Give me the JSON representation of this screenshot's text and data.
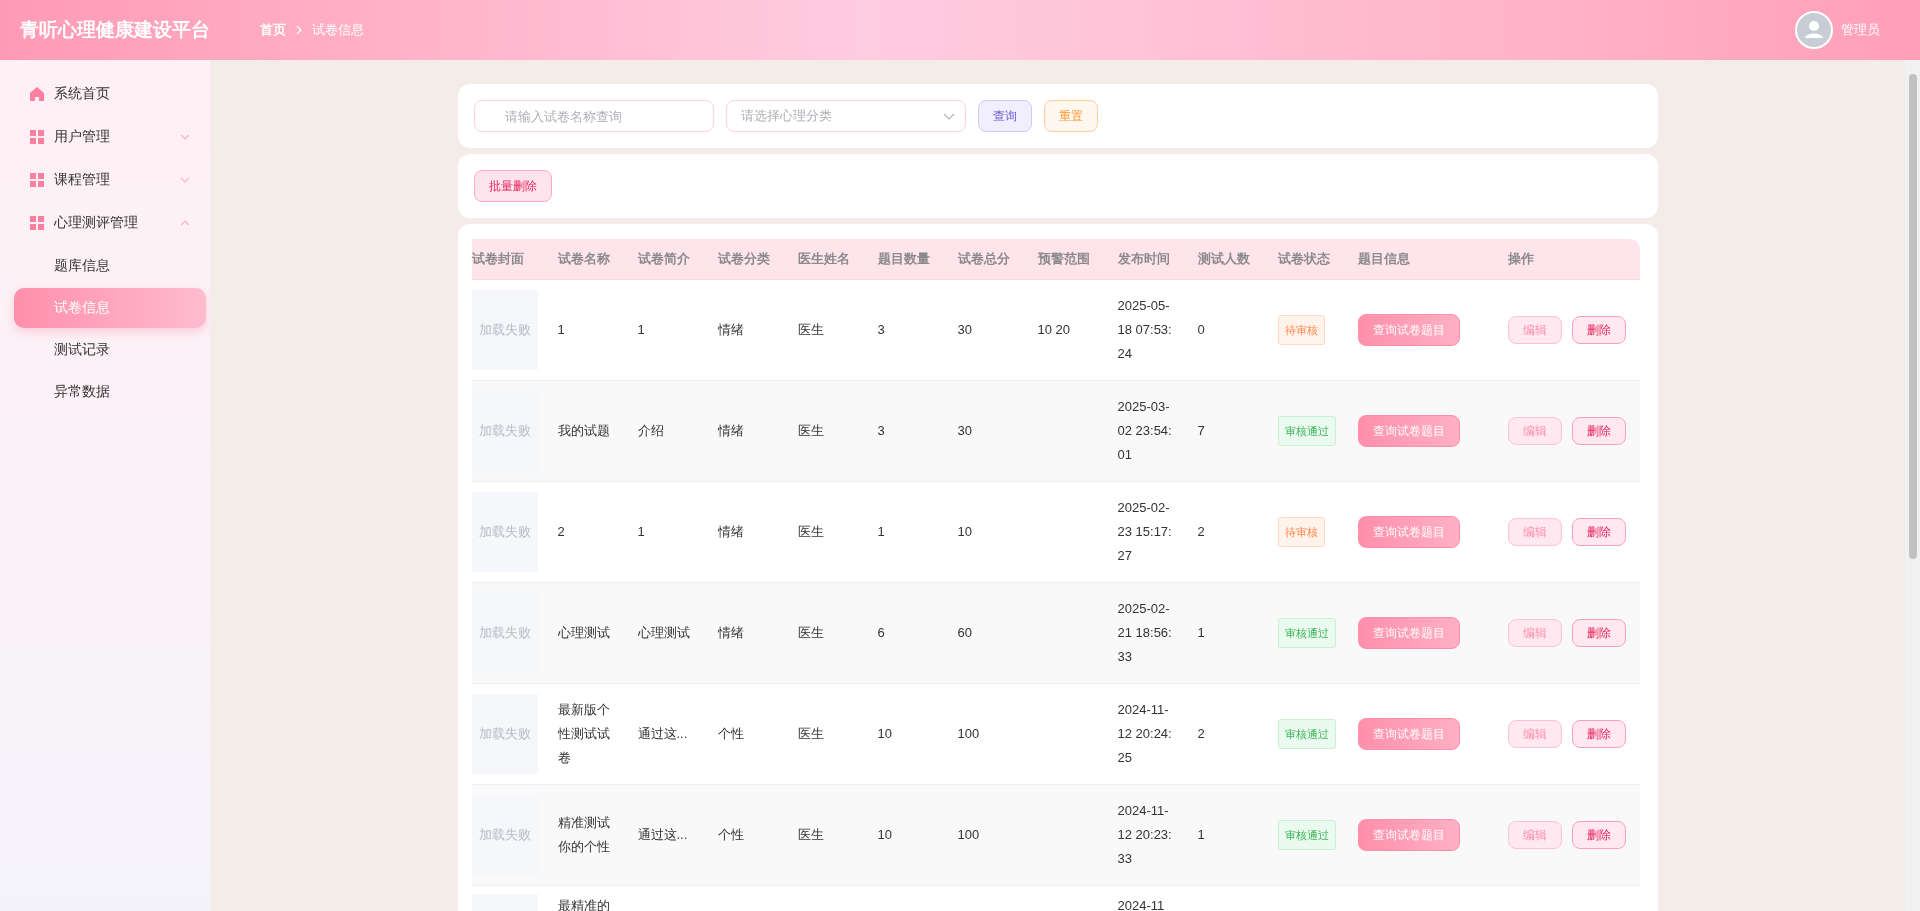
{
  "header": {
    "title": "青听心理健康建设平台",
    "breadcrumb": [
      "首页",
      "试卷信息"
    ],
    "user": "管理员"
  },
  "sidebar": {
    "items": [
      {
        "label": "系统首页",
        "kind": "home"
      },
      {
        "label": "用户管理",
        "kind": "group",
        "expanded": false
      },
      {
        "label": "课程管理",
        "kind": "group",
        "expanded": false
      },
      {
        "label": "心理测评管理",
        "kind": "group",
        "expanded": true,
        "children": [
          {
            "label": "题库信息",
            "selected": false
          },
          {
            "label": "试卷信息",
            "selected": true
          },
          {
            "label": "测试记录",
            "selected": false
          },
          {
            "label": "异常数据",
            "selected": false
          }
        ]
      }
    ]
  },
  "search": {
    "name_placeholder": "请输入试卷名称查询",
    "category_placeholder": "请选择心理分类",
    "query": "查询",
    "reset": "重置"
  },
  "batch_delete": "批量删除",
  "table": {
    "columns": [
      "试卷封面",
      "试卷名称",
      "试卷简介",
      "试卷分类",
      "医生姓名",
      "题目数量",
      "试卷总分",
      "预警范围",
      "发布时间",
      "测试人数",
      "试卷状态",
      "题目信息",
      "操作"
    ],
    "rows": [
      {
        "cover": "加载失败",
        "name": "1",
        "intro": "1",
        "category": "情绪",
        "doctor": "医生",
        "count": "3",
        "total": "30",
        "range": "10 20",
        "time": "2025-05-18 07:53:24",
        "testers": "0",
        "status": {
          "label": "待审核",
          "kind": "pending"
        },
        "info": "查询试卷题目",
        "edit": "编辑",
        "delete": "删除"
      },
      {
        "cover": "加载失败",
        "name": "我的试题",
        "intro": "介绍",
        "category": "情绪",
        "doctor": "医生",
        "count": "3",
        "total": "30",
        "time": "2025-03-02 23:54:01",
        "testers": "7",
        "status": {
          "label": "审核通过",
          "kind": "approved"
        },
        "info": "查询试卷题目",
        "edit": "编辑",
        "delete": "删除"
      },
      {
        "cover": "加载失败",
        "name": "2",
        "intro": "1",
        "category": "情绪",
        "doctor": "医生",
        "count": "1",
        "total": "10",
        "time": "2025-02-23 15:17:27",
        "testers": "2",
        "status": {
          "label": "待审核",
          "kind": "pending"
        },
        "info": "查询试卷题目",
        "edit": "编辑",
        "delete": "删除"
      },
      {
        "cover": "加载失败",
        "name": "心理测试",
        "intro": "心理测试",
        "category": "情绪",
        "doctor": "医生",
        "count": "6",
        "total": "60",
        "time": "2025-02-21 18:56:33",
        "testers": "1",
        "status": {
          "label": "审核通过",
          "kind": "approved"
        },
        "info": "查询试卷题目",
        "edit": "编辑",
        "delete": "删除"
      },
      {
        "cover": "加载失败",
        "name": "最新版个性测试试卷",
        "intro": "通过这...",
        "category": "个性",
        "doctor": "医生",
        "count": "10",
        "total": "100",
        "time": "2024-11-12 20:24:25",
        "testers": "2",
        "status": {
          "label": "审核通过",
          "kind": "approved"
        },
        "info": "查询试卷题目",
        "edit": "编辑",
        "delete": "删除"
      },
      {
        "cover": "加载失败",
        "name": "精准测试你的个性",
        "intro": "通过这...",
        "category": "个性",
        "doctor": "医生",
        "count": "10",
        "total": "100",
        "time": "2024-11-12 20:23:33",
        "testers": "1",
        "status": {
          "label": "审核通过",
          "kind": "approved"
        },
        "info": "查询试卷题目",
        "edit": "编辑",
        "delete": "删除"
      },
      {
        "name": "最精准的",
        "time": "2024-11"
      }
    ]
  }
}
